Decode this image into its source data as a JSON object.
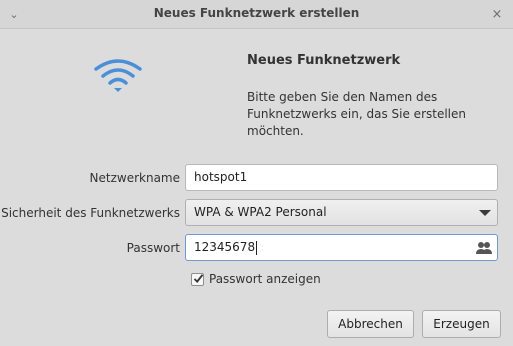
{
  "window": {
    "title": "Neues Funknetzwerk erstellen",
    "close_glyph": "×",
    "menu_glyph": "⌄"
  },
  "header": {
    "heading": "Neues Funknetzwerk",
    "description": "Bitte geben Sie den Namen des Funknetzwerks ein, das Sie erstellen möchten.",
    "icon": "wifi-icon",
    "icon_color": "#4a90d9"
  },
  "form": {
    "network_name_label": "Netzwerkname",
    "network_name_value": "hotspot1",
    "security_label": "Sicherheit des Funknetzwerks",
    "security_value": "WPA & WPA2 Personal",
    "password_label": "Passwort",
    "password_value": "12345678",
    "show_password_label": "Passwort anzeigen",
    "show_password_checked": true
  },
  "buttons": {
    "cancel": "Abbrechen",
    "create": "Erzeugen"
  }
}
